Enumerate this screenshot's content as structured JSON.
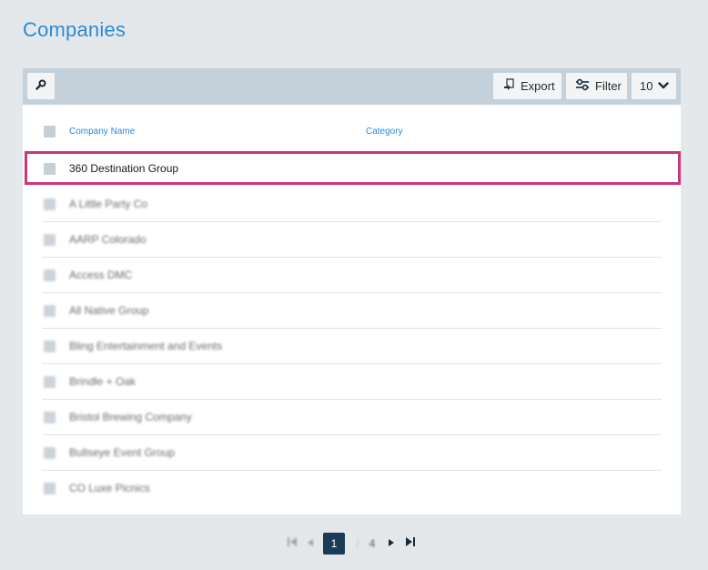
{
  "page": {
    "title": "Companies"
  },
  "toolbar": {
    "export_label": "Export",
    "filter_label": "Filter",
    "page_size": "10"
  },
  "table": {
    "columns": [
      "Company Name",
      "Category"
    ],
    "rows": [
      {
        "name": "360 Destination Group",
        "category": ""
      },
      {
        "name": "A Little Party Co",
        "category": ""
      },
      {
        "name": "AARP Colorado",
        "category": ""
      },
      {
        "name": "Access DMC",
        "category": ""
      },
      {
        "name": "All Native Group",
        "category": ""
      },
      {
        "name": "Bling Entertainment and Events",
        "category": ""
      },
      {
        "name": "Brindle + Oak",
        "category": ""
      },
      {
        "name": "Bristol Brewing Company",
        "category": ""
      },
      {
        "name": "Bullseye Event Group",
        "category": ""
      },
      {
        "name": "CO Luxe Picnics",
        "category": ""
      }
    ],
    "highlighted_row": 0
  },
  "pagination": {
    "current_page": "1",
    "separator": "/",
    "total_pages": "4"
  },
  "colors": {
    "accent": "#2b8ad8",
    "toolbar_bg": "#c5d1da",
    "highlight": "#c9377d",
    "pager_active": "#1b3b57"
  }
}
